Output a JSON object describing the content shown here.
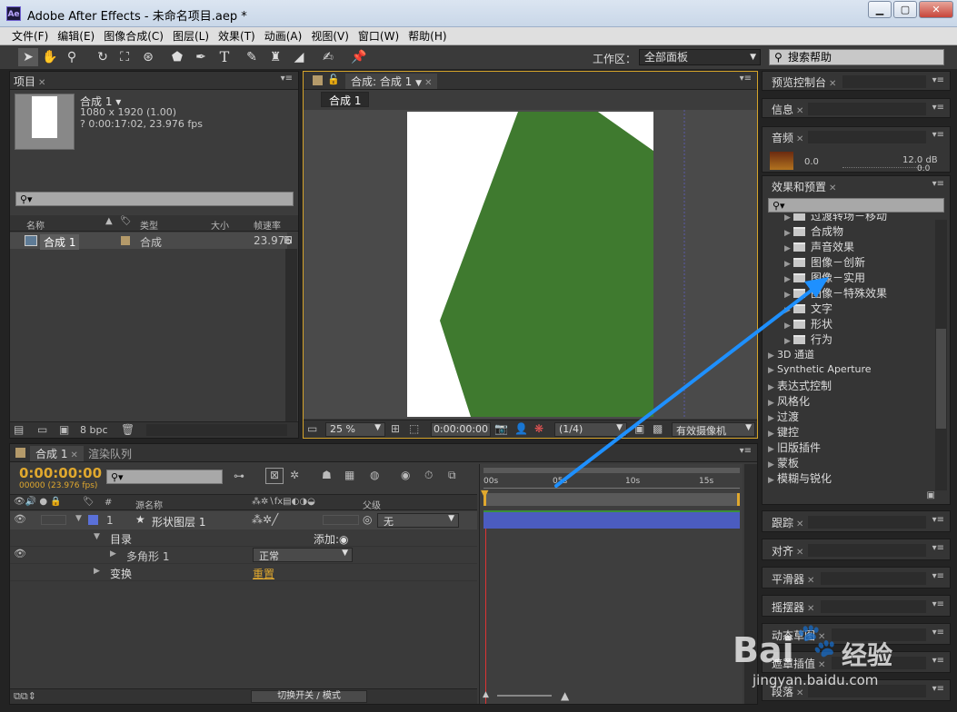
{
  "app": {
    "title": "Adobe After Effects - 未命名项目.aep *",
    "logo": "Ae",
    "min": "▁",
    "max": "▢",
    "close": "✕"
  },
  "menu": [
    "文件(F)",
    "编辑(E)",
    "图像合成(C)",
    "图层(L)",
    "效果(T)",
    "动画(A)",
    "视图(V)",
    "窗口(W)",
    "帮助(H)"
  ],
  "toolbar": {
    "workspace_label": "工作区：",
    "workspace_value": "全部面板",
    "search_placeholder": "搜索帮助",
    "tools": [
      "selection-tool-icon",
      "hand-tool-icon",
      "zoom-tool-icon",
      "rotate-tool-icon",
      "camera-orbit-icon",
      "pan-behind-icon",
      "shape-tool-icon",
      "pen-tool-icon",
      "type-tool-icon",
      "brush-tool-icon",
      "stamp-tool-icon",
      "eraser-tool-icon",
      "roto-brush-icon",
      "puppet-pin-icon"
    ]
  },
  "project": {
    "tab": "项目",
    "comp_name": "合成 1",
    "comp_dims": "1080 x 1920 (1.00)",
    "comp_duration": "? 0:00:17:02, 23.976 fps",
    "columns": {
      "name": "名称",
      "type": "类型",
      "size": "大小",
      "fps": "帧速率"
    },
    "item": {
      "name": "合成 1",
      "type": "合成",
      "fps": "23.976"
    },
    "bpc": "8 bpc"
  },
  "viewer": {
    "tab": "合成: 合成 1",
    "subtab": "合成 1",
    "zoom": "25 %",
    "timecode": "0:00:00:00",
    "resolution": "(1/4)",
    "camera": "有效摄像机"
  },
  "preview": {
    "tab": "预览控制台"
  },
  "info": {
    "tab": "信息"
  },
  "audio": {
    "tab": "音频",
    "level_left": "0.0",
    "level_right": "12.0 dB",
    "level_right2": "0.0"
  },
  "effects": {
    "tab": "效果和预置",
    "items": [
      {
        "label": "过渡转场－移动",
        "indent": 1,
        "folder": true
      },
      {
        "label": "合成物",
        "indent": 1,
        "folder": true
      },
      {
        "label": "声音效果",
        "indent": 1,
        "folder": true
      },
      {
        "label": "图像－创新",
        "indent": 1,
        "folder": true
      },
      {
        "label": "图像－实用",
        "indent": 1,
        "folder": true
      },
      {
        "label": "图像－特殊效果",
        "indent": 1,
        "folder": true
      },
      {
        "label": "文字",
        "indent": 1,
        "folder": true
      },
      {
        "label": "形状",
        "indent": 1,
        "folder": true
      },
      {
        "label": "行为",
        "indent": 1,
        "folder": true
      },
      {
        "label": "3D 通道",
        "indent": 0,
        "folder": false
      },
      {
        "label": "Synthetic Aperture",
        "indent": 0,
        "folder": false
      },
      {
        "label": "表达式控制",
        "indent": 0,
        "folder": false
      },
      {
        "label": "风格化",
        "indent": 0,
        "folder": false
      },
      {
        "label": "过渡",
        "indent": 0,
        "folder": false
      },
      {
        "label": "键控",
        "indent": 0,
        "folder": false
      },
      {
        "label": "旧版插件",
        "indent": 0,
        "folder": false
      },
      {
        "label": "蒙板",
        "indent": 0,
        "folder": false
      },
      {
        "label": "模糊与锐化",
        "indent": 0,
        "folder": false
      }
    ]
  },
  "right_panels": [
    "跟踪",
    "对齐",
    "平滑器",
    "摇摆器",
    "动态草图",
    "遮罩插值",
    "段落"
  ],
  "timeline": {
    "tab": "合成 1",
    "tab2": "渲染队列",
    "timecode": "0:00:00:00",
    "fps_info": "00000 (23.976 fps)",
    "col_num": "#",
    "col_source": "源名称",
    "col_parent": "父级",
    "ruler": [
      "00s",
      "05s",
      "10s",
      "15s"
    ],
    "layer": {
      "num": "1",
      "name": "形状图层 1",
      "parent": "无"
    },
    "contents": "目录",
    "add": "添加:",
    "polygon": "多角形 1",
    "blend": "正常",
    "transform": "变换",
    "reset": "重置",
    "toggle": "切换开关 / 模式"
  },
  "watermark": {
    "brand": "Bai",
    "brand2": "经验",
    "url": "jingyan.baidu.com"
  },
  "colors": {
    "green": "#3f7a2f",
    "accent": "#e0a82e",
    "arrow": "#1e90ff"
  }
}
